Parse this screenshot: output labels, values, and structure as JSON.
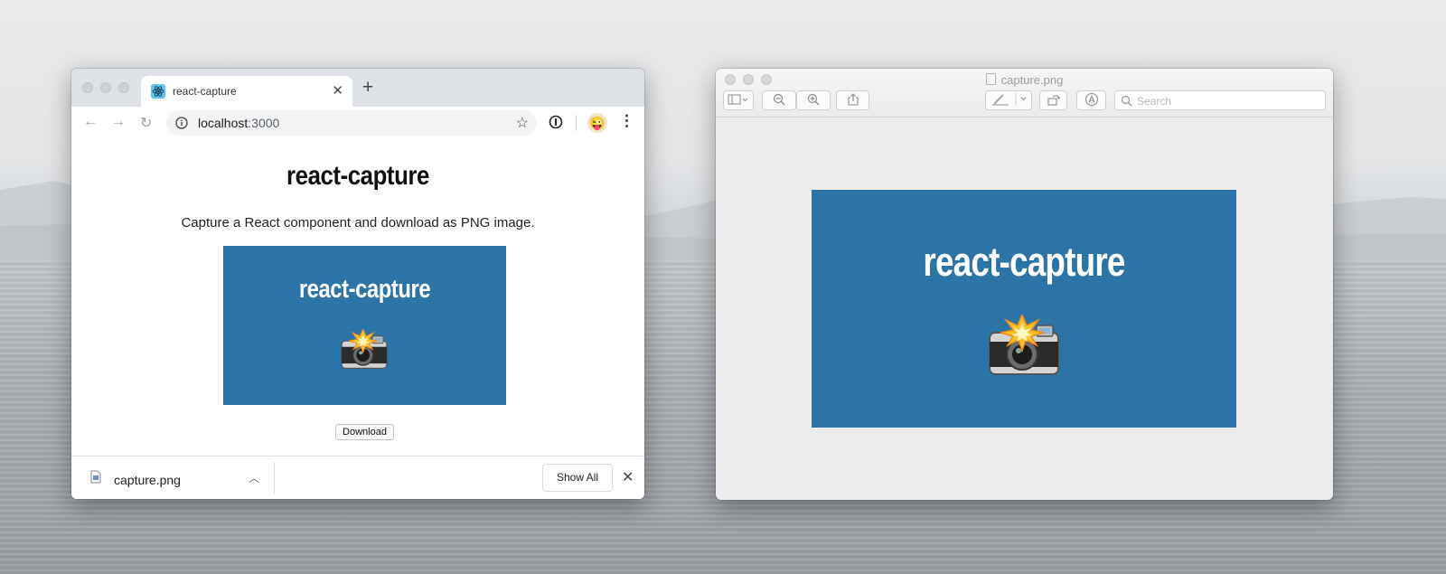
{
  "browser": {
    "tab_title": "react-capture",
    "url_host": "localhost",
    "url_port": ":3000",
    "page": {
      "title": "react-capture",
      "description": "Capture a React component and download as PNG image.",
      "card_title": "react-capture",
      "card_icon": "camera-with-flash-icon",
      "card_color": "#2a74a8",
      "download_label": "Download"
    },
    "download_bar": {
      "file_name": "capture.png",
      "show_all_label": "Show All"
    }
  },
  "preview": {
    "window_title": "capture.png",
    "search_placeholder": "Search",
    "image_title": "react-capture",
    "image_icon": "camera-with-flash-icon"
  }
}
